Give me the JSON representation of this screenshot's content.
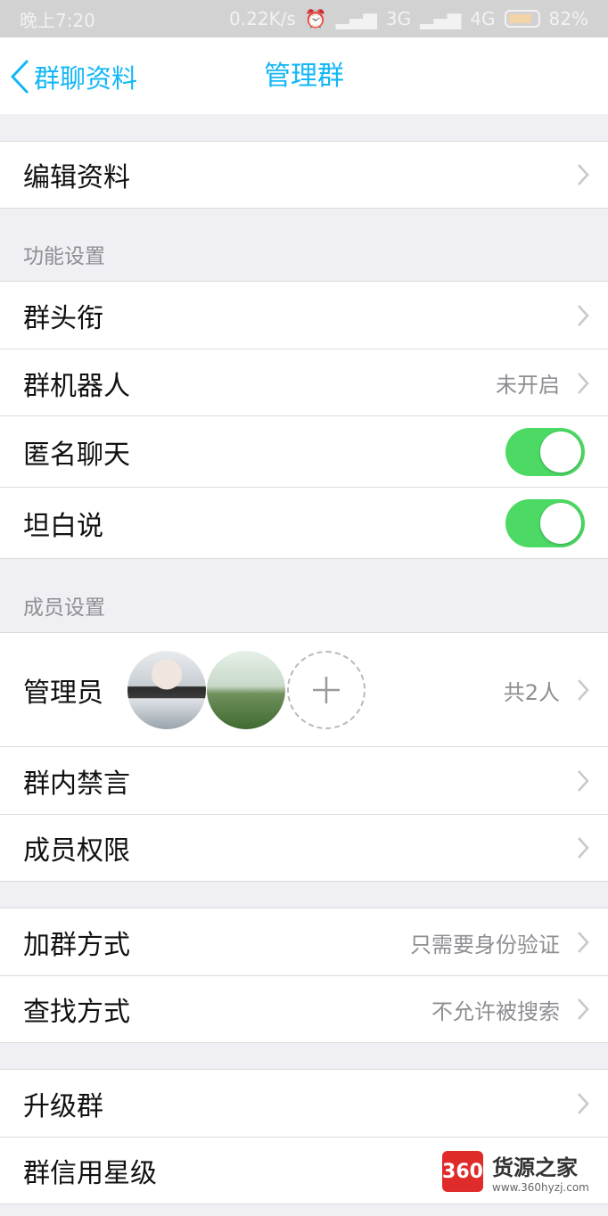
{
  "status_bar": {
    "time": "晚上7:20",
    "speed": "0.22K/s",
    "network_3g": "3G",
    "network_4g": "4G",
    "battery": "82%",
    "icons": [
      "alarm-icon",
      "signal-icon",
      "battery-icon"
    ]
  },
  "nav": {
    "back_label": "群聊资料",
    "title": "管理群",
    "accent": "#12b7f5"
  },
  "edit_profile": {
    "label": "编辑资料"
  },
  "function_settings": {
    "header": "功能设置",
    "group_title": {
      "label": "群头衔"
    },
    "group_robot": {
      "label": "群机器人",
      "value": "未开启"
    },
    "anonymous_chat": {
      "label": "匿名聊天",
      "enabled": true
    },
    "honest_talk": {
      "label": "坦白说",
      "enabled": true
    },
    "toggle_color": "#4cd964"
  },
  "member_settings": {
    "header": "成员设置",
    "admins": {
      "label": "管理员",
      "value": "共2人",
      "avatars": [
        "avatar-girl",
        "avatar-runner"
      ]
    },
    "mute": {
      "label": "群内禁言"
    },
    "permissions": {
      "label": "成员权限"
    }
  },
  "join": {
    "join_method": {
      "label": "加群方式",
      "value": "只需要身份验证"
    },
    "search_method": {
      "label": "查找方式",
      "value": "不允许被搜索"
    }
  },
  "upgrade": {
    "upgrade_group": {
      "label": "升级群"
    },
    "credit_stars": {
      "label": "群信用星级"
    }
  },
  "watermark": {
    "badge": "360",
    "name": "货源之家",
    "url": "www.360hyzj.com"
  }
}
